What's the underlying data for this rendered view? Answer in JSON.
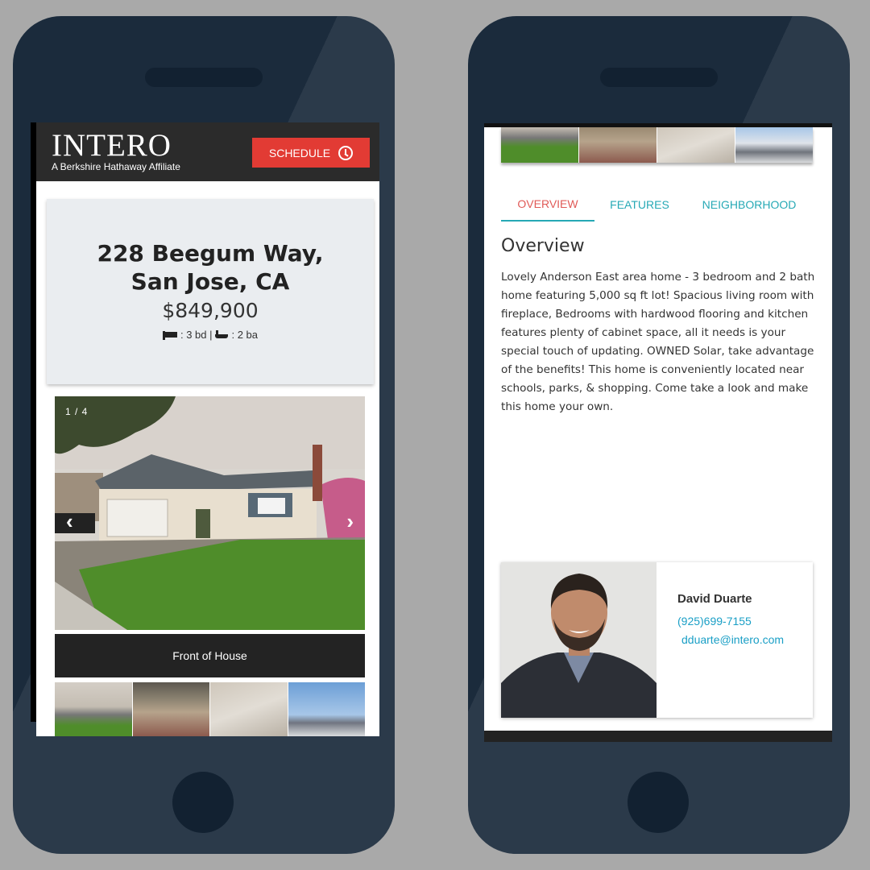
{
  "left_phone": {
    "header": {
      "logo": "INTERO",
      "tagline": "A Berkshire Hathaway Affiliate",
      "schedule_label": "SCHEDULE"
    },
    "listing": {
      "address": "228 Beegum Way, San Jose, CA",
      "price": "$849,900",
      "beds_text": ": 3 bd |",
      "baths_text": ": 2 ba"
    },
    "gallery": {
      "counter": "1 / 4",
      "prev_arrow": "‹",
      "next_arrow": "›",
      "caption": "Front of House"
    }
  },
  "right_phone": {
    "tabs": [
      "OVERVIEW",
      "FEATURES",
      "NEIGHBORHOOD"
    ],
    "overview": {
      "heading": "Overview",
      "text": "Lovely Anderson East area home - 3 bedroom and 2 bath home featuring 5,000 sq ft lot! Spacious living room with fireplace, Bedrooms with hardwood flooring and kitchen features plenty of cabinet space, all it needs is your special touch of updating. OWNED Solar, take advantage of the benefits! This home is conveniently located near schools, parks, & shopping. Come take a look and make this home your own."
    },
    "agent": {
      "name": "David Duarte",
      "phone": "(925)699-7155",
      "email": "dduarte@intero.com"
    }
  },
  "colors": {
    "phone_body": "#1b2b3c",
    "background": "#a9a9a9",
    "accent_red": "#e23b34",
    "tab_teal": "#26a9b5",
    "link_blue": "#1a9fc6"
  }
}
